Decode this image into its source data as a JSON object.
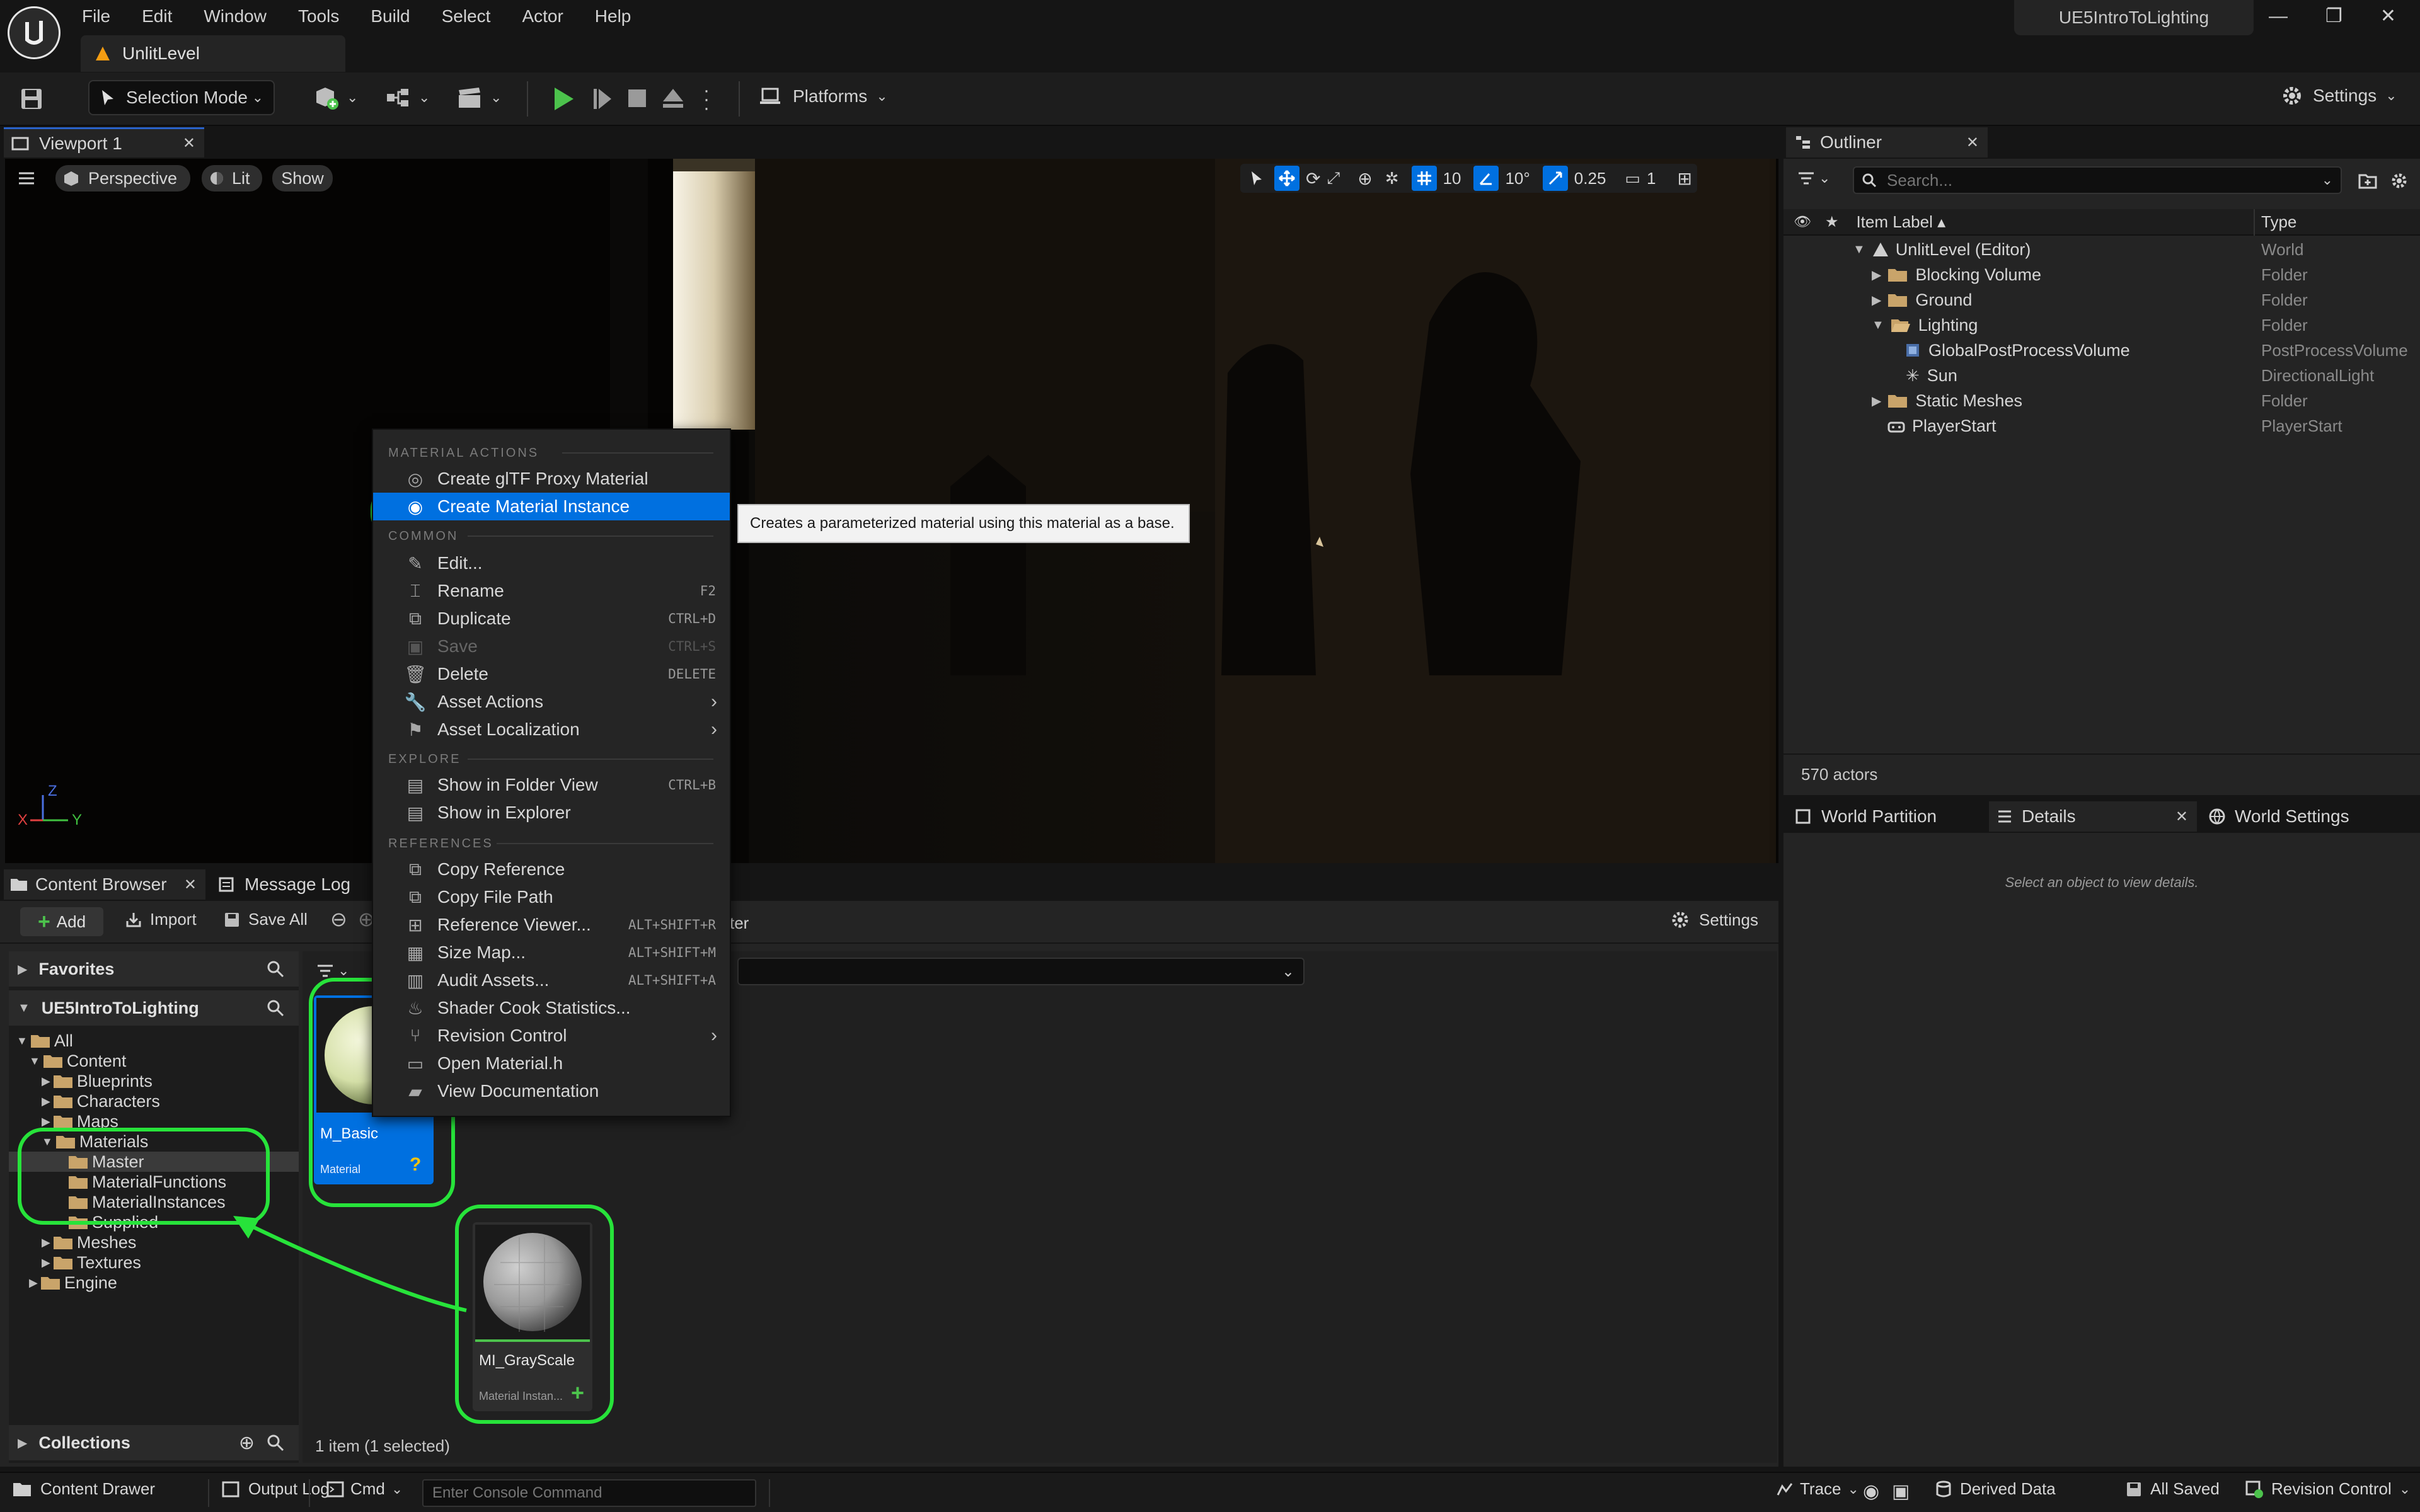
{
  "app": {
    "project_name": "UE5IntroToLighting",
    "level_tab": "UnlitLevel",
    "menu": [
      "File",
      "Edit",
      "Window",
      "Tools",
      "Build",
      "Select",
      "Actor",
      "Help"
    ]
  },
  "toolbar": {
    "mode_label": "Selection Mode",
    "platforms_label": "Platforms",
    "settings_label": "Settings"
  },
  "viewport": {
    "tab_label": "Viewport 1",
    "view_mode": "Perspective",
    "lit_label": "Lit",
    "show_label": "Show",
    "grid_snap": "10",
    "rotation_snap": "10°",
    "scale_snap": "0.25",
    "camera_speed": "1",
    "axis_z": "Z",
    "axis_x": "X",
    "axis_y": "Y"
  },
  "outliner": {
    "tab_label": "Outliner",
    "search_placeholder": "Search...",
    "col_label": "Item Label ▴",
    "col_type": "Type",
    "rows": [
      {
        "label": "UnlitLevel (Editor)",
        "type": "World"
      },
      {
        "label": "Blocking Volume",
        "type": "Folder"
      },
      {
        "label": "Ground",
        "type": "Folder"
      },
      {
        "label": "Lighting",
        "type": "Folder"
      },
      {
        "label": "GlobalPostProcessVolume",
        "type": "PostProcessVolume"
      },
      {
        "label": "Sun",
        "type": "DirectionalLight"
      },
      {
        "label": "Static Meshes",
        "type": "Folder"
      },
      {
        "label": "PlayerStart",
        "type": "PlayerStart"
      }
    ],
    "actor_count": "570 actors"
  },
  "details": {
    "tabs": [
      "World Partition",
      "Details",
      "World Settings"
    ],
    "empty_text": "Select an object to view details."
  },
  "content_browser": {
    "tab_label": "Content Browser",
    "message_log_tab": "Message Log",
    "add_label": "Add",
    "import_label": "Import",
    "save_all_label": "Save All",
    "path_tail": "ter",
    "settings_label": "Settings",
    "favorites_label": "Favorites",
    "project_label": "UE5IntroToLighting",
    "tree": [
      "All",
      "Content",
      "Blueprints",
      "Characters",
      "Maps",
      "Materials",
      "Master",
      "MaterialFunctions",
      "MaterialInstances",
      "Supplied",
      "Meshes",
      "Textures",
      "Engine"
    ],
    "collections_label": "Collections",
    "status": "1 item (1 selected)",
    "assets": [
      {
        "name": "M_Basic",
        "type": "Material"
      },
      {
        "name": "MI_GrayScale",
        "type": "Material Instan..."
      }
    ]
  },
  "context_menu": {
    "sections": [
      "MATERIAL ACTIONS",
      "COMMON",
      "EXPLORE",
      "REFERENCES"
    ],
    "items": [
      {
        "label": "Create glTF Proxy Material",
        "shortcut": ""
      },
      {
        "label": "Create Material Instance",
        "shortcut": ""
      },
      {
        "label": "Edit...",
        "shortcut": ""
      },
      {
        "label": "Rename",
        "shortcut": "F2"
      },
      {
        "label": "Duplicate",
        "shortcut": "CTRL+D"
      },
      {
        "label": "Save",
        "shortcut": "CTRL+S"
      },
      {
        "label": "Delete",
        "shortcut": "DELETE"
      },
      {
        "label": "Asset Actions",
        "shortcut": ""
      },
      {
        "label": "Asset Localization",
        "shortcut": ""
      },
      {
        "label": "Show in Folder View",
        "shortcut": "CTRL+B"
      },
      {
        "label": "Show in Explorer",
        "shortcut": ""
      },
      {
        "label": "Copy Reference",
        "shortcut": ""
      },
      {
        "label": "Copy File Path",
        "shortcut": ""
      },
      {
        "label": "Reference Viewer...",
        "shortcut": "ALT+SHIFT+R"
      },
      {
        "label": "Size Map...",
        "shortcut": "ALT+SHIFT+M"
      },
      {
        "label": "Audit Assets...",
        "shortcut": "ALT+SHIFT+A"
      },
      {
        "label": "Shader Cook Statistics...",
        "shortcut": ""
      },
      {
        "label": "Revision Control",
        "shortcut": ""
      },
      {
        "label": "Open Material.h",
        "shortcut": ""
      },
      {
        "label": "View Documentation",
        "shortcut": ""
      }
    ],
    "tooltip": "Creates a parameterized material using this material as a base."
  },
  "statusbar": {
    "content_drawer": "Content Drawer",
    "output_log": "Output Log",
    "cmd": "Cmd",
    "console_placeholder": "Enter Console Command",
    "trace": "Trace",
    "derived_data": "Derived Data",
    "all_saved": "All Saved",
    "revision_control": "Revision Control"
  },
  "colors": {
    "accent_blue": "#0070e0",
    "highlight_green": "#27e33a",
    "play_green": "#4cc24c",
    "folder": "#c9a46a"
  }
}
